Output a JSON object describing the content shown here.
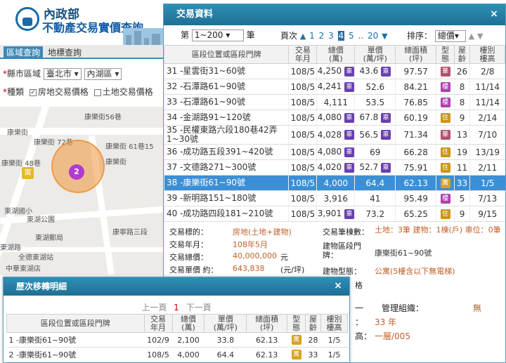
{
  "site": {
    "title_top": "內政部",
    "title_main": "不動產交易實價查詢"
  },
  "side_tabs": [
    "區域查詢",
    "地標查詢"
  ],
  "filter": {
    "region_label": "縣市區域",
    "city": "臺北市",
    "district": "內湖區",
    "type_label": "種類",
    "opt_house": "房地交易價格",
    "opt_land": "土地交易價格"
  },
  "map": {
    "labels": [
      "康樂街56巷",
      "康樂街",
      "康樂街 72巷",
      "康樂街 48巷",
      "康樂街 61巷15",
      "東湖國小",
      "康樂街",
      "東湖公園",
      "東湖郵局",
      "東湖路",
      "全德東湖站",
      "康寧路三段",
      "中華東湖店",
      "東湖路",
      "東湖路",
      "東湖"
    ],
    "cluster_count": "2",
    "poi_icon": "寓"
  },
  "panel": {
    "title": "交易資料",
    "close": "×",
    "pager": {
      "prefix": "第",
      "range": "1~200",
      "suffix": "筆",
      "page_label": "頁次",
      "pages": [
        "1",
        "2",
        "3",
        "4",
        "5",
        "..",
        "20"
      ],
      "current": "4",
      "sort_label": "排序：",
      "sort_value": "總價"
    },
    "columns": [
      "區段位置或區段門牌",
      "交易\n年月",
      "總價\n(萬)",
      "單價\n(萬/坪)",
      "總面積\n(坪)",
      "型\n態",
      "屋\n齡",
      "樓別\n樓高"
    ],
    "rows": [
      {
        "no": "31",
        "addr": "-星雲街31~60號",
        "ym": "108/5",
        "total": "4,250",
        "car": "車",
        "unit": "43.6",
        "unit_badge": "車",
        "area": "97.57",
        "type": "華",
        "age": "26",
        "floor": "2/8"
      },
      {
        "no": "32",
        "addr": "-石潭路61~90號",
        "ym": "108/5",
        "total": "4,241",
        "car": "車",
        "unit": "52.6",
        "unit_badge": "",
        "area": "84.21",
        "type": "樓",
        "age": "8",
        "floor": "11/14"
      },
      {
        "no": "33",
        "addr": "-石潭路61~90號",
        "ym": "108/5",
        "total": "4,111",
        "car": "",
        "unit": "53.5",
        "unit_badge": "",
        "area": "76.85",
        "type": "樓",
        "age": "8",
        "floor": "11/14"
      },
      {
        "no": "34",
        "addr": "-金湖路91~120號",
        "ym": "108/5",
        "total": "4,080",
        "car": "車",
        "unit": "67.8",
        "unit_badge": "車",
        "area": "60.19",
        "type": "住",
        "age": "9",
        "floor": "2/14"
      },
      {
        "no": "35",
        "addr": "-民權東路六段180巷42弄1~30號",
        "ym": "108/5",
        "total": "4,028",
        "car": "車",
        "unit": "56.5",
        "unit_badge": "車",
        "area": "71.34",
        "type": "華",
        "age": "13",
        "floor": "7/10"
      },
      {
        "no": "36",
        "addr": "-成功路五段391~420號",
        "ym": "108/5",
        "total": "4,080",
        "car": "車",
        "unit": "69",
        "unit_badge": "",
        "area": "66.28",
        "type": "住",
        "age": "19",
        "floor": "13/19"
      },
      {
        "no": "37",
        "addr": "-文德路271~300號",
        "ym": "108/5",
        "total": "4,020",
        "car": "車",
        "unit": "52.7",
        "unit_badge": "車",
        "area": "75.91",
        "type": "住",
        "age": "11",
        "floor": "2/11"
      },
      {
        "no": "38",
        "addr": "-康樂街61~90號",
        "ym": "108/5",
        "total": "4,000",
        "car": "",
        "unit": "64.4",
        "unit_badge": "",
        "area": "62.13",
        "type": "寓",
        "age": "33",
        "floor": "1/5",
        "highlight": true
      },
      {
        "no": "39",
        "addr": "-新明路151~180號",
        "ym": "108/5",
        "total": "3,916",
        "car": "",
        "unit": "41",
        "unit_badge": "",
        "area": "95.49",
        "type": "樓",
        "age": "5",
        "floor": "7/13"
      },
      {
        "no": "40",
        "addr": "-成功路四段181~210號",
        "ym": "108/5",
        "total": "3,901",
        "car": "車",
        "unit": "73.2",
        "unit_badge": "",
        "area": "65.25",
        "type": "住",
        "age": "9",
        "floor": "9/15"
      }
    ],
    "detail": {
      "target_label": "交易標的：",
      "target_value": "房地(土地+建物)",
      "ym_label": "交易年月：",
      "ym_value": "108年5月",
      "total_label": "交易總價：",
      "total_value": "40,000,000",
      "total_unit": "元",
      "unit_label": "交易單價 約：",
      "unit_value": "643,838",
      "unit_unit": "(元/坪)",
      "count_label": "交易筆棟數：",
      "count_value": "土地：3筆 建物：1棟(戶) 車位：0筆",
      "bldg_addr_label": "建物區段門牌：",
      "bldg_addr_value": "康樂街61~90號",
      "bldg_type_label": "建物型態：",
      "bldg_type_value": "公寓(5樓含以下無電梯)",
      "partial_label": "格",
      "mgmt_label": "管理組織：",
      "mgmt_value": "無",
      "age_value": "33 年",
      "floor_value": "一層/005",
      "left_frag1": "一",
      "left_frag2": "：",
      "left_frag3": "高："
    }
  },
  "history": {
    "title": "歷次移轉明細",
    "close": "×",
    "prev": "上一頁",
    "page": "1",
    "next": "下一頁",
    "columns": [
      "區段位置或區段門牌",
      "交易\n年月",
      "總價\n(萬)",
      "單價\n(萬/坪)",
      "總面積\n(坪)",
      "型\n態",
      "屋\n齡",
      "樓別\n樓高"
    ],
    "rows": [
      {
        "no": "1",
        "addr": "-康樂街61~90號",
        "ym": "102/9",
        "total": "2,100",
        "unit": "33.8",
        "area": "62.13",
        "type": "寓",
        "age": "28",
        "floor": "1/5"
      },
      {
        "no": "2",
        "addr": "-康樂街61~90號",
        "ym": "108/5",
        "total": "4,000",
        "unit": "64.4",
        "area": "62.13",
        "type": "寓",
        "age": "33",
        "floor": "1/5"
      }
    ]
  }
}
